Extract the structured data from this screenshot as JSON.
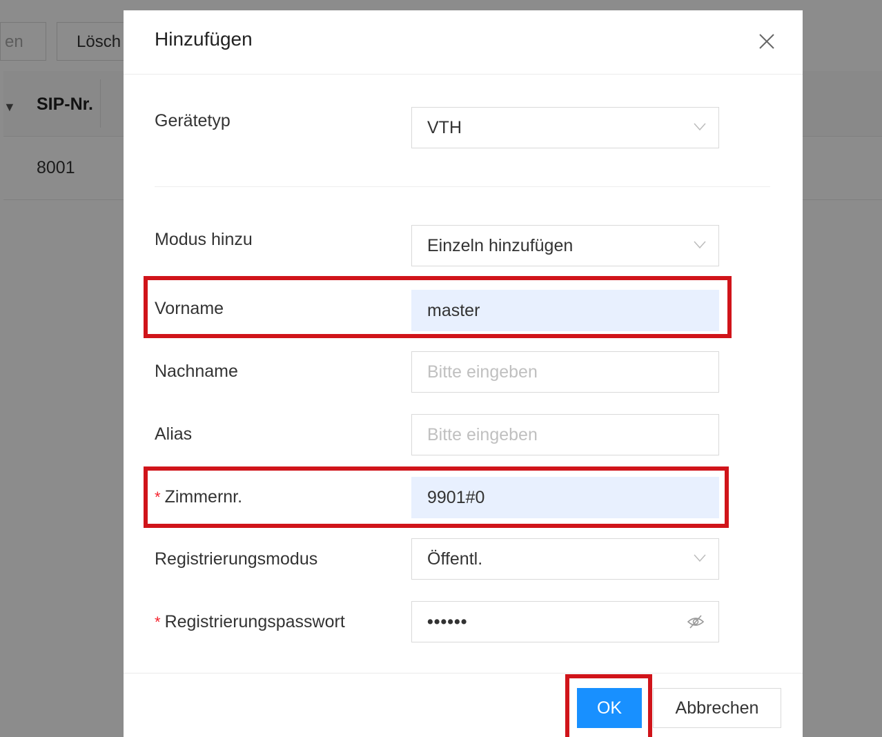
{
  "background": {
    "toolbar_buttons": [
      "en",
      "Lösch"
    ],
    "table_header": "SIP-Nr.",
    "table_rows": [
      "8001"
    ]
  },
  "modal": {
    "title": "Hinzufügen",
    "close_icon": "close-icon",
    "fields": {
      "device_type": {
        "label": "Gerätetyp",
        "value": "VTH"
      },
      "add_mode": {
        "label": "Modus hinzu",
        "value": "Einzeln hinzufügen"
      },
      "first_name": {
        "label": "Vorname",
        "value": "master"
      },
      "last_name": {
        "label": "Nachname",
        "value": "",
        "placeholder": "Bitte eingeben"
      },
      "alias": {
        "label": "Alias",
        "value": "",
        "placeholder": "Bitte eingeben"
      },
      "room_no": {
        "label": "Zimmernr.",
        "value": "9901#0",
        "required": true
      },
      "registration_mode": {
        "label": "Registrierungsmodus",
        "value": "Öffentl."
      },
      "registration_password": {
        "label": "Registrierungspasswort",
        "value": "••••••",
        "required": true
      }
    },
    "required_mark": "*",
    "buttons": {
      "ok": "OK",
      "cancel": "Abbrechen"
    }
  },
  "colors": {
    "primary": "#1890ff",
    "highlight": "#d0141a",
    "filled_bg": "#e8f0fe",
    "required": "#f5222d"
  }
}
